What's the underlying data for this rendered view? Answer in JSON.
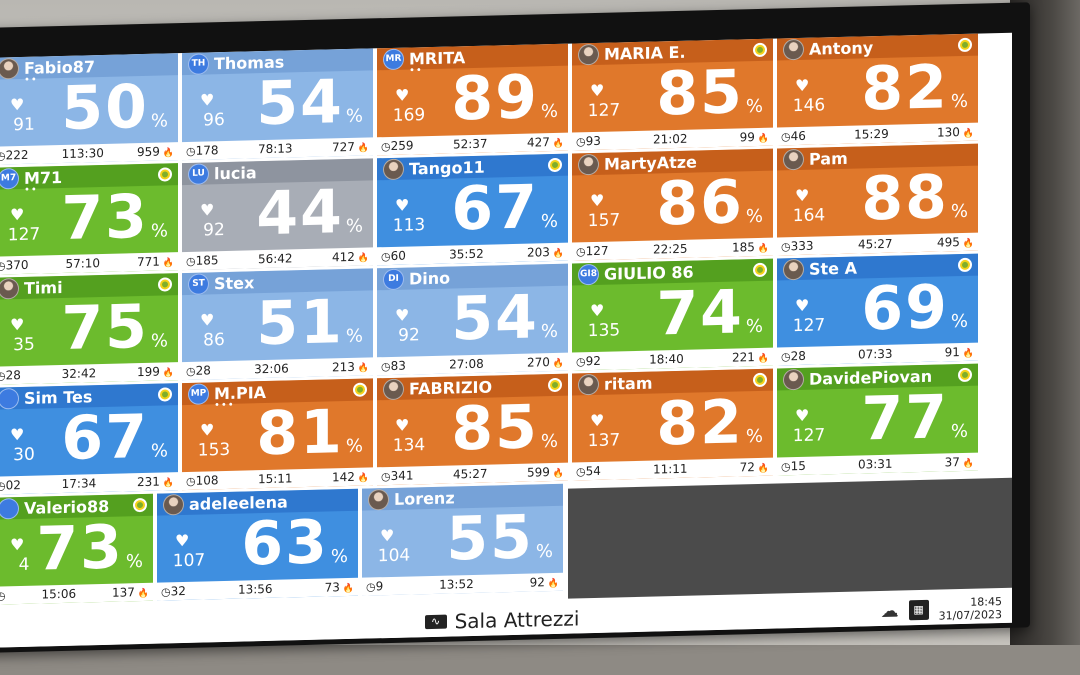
{
  "footer": {
    "room_title": "Sala Attrezzi",
    "time": "18:45",
    "date": "31/07/2023"
  },
  "tiles": [
    {
      "name": "Fabio87",
      "initials": "",
      "photo": true,
      "color": "lblue",
      "bpm": "91",
      "pct": "50",
      "stat1": "222",
      "time": "113:30",
      "kcal": "959",
      "target": false,
      "dots": "••"
    },
    {
      "name": "Thomas",
      "initials": "TH",
      "photo": false,
      "color": "lblue",
      "bpm": "96",
      "pct": "54",
      "stat1": "178",
      "time": "78:13",
      "kcal": "727",
      "target": false,
      "dots": ""
    },
    {
      "name": "MRITA",
      "initials": "MR",
      "photo": false,
      "color": "orange",
      "bpm": "169",
      "pct": "89",
      "stat1": "259",
      "time": "52:37",
      "kcal": "427",
      "target": false,
      "dots": "••"
    },
    {
      "name": "MARIA E.",
      "initials": "",
      "photo": true,
      "color": "orange",
      "bpm": "127",
      "pct": "85",
      "stat1": "93",
      "time": "21:02",
      "kcal": "99",
      "target": true,
      "dots": ""
    },
    {
      "name": "Antony",
      "initials": "",
      "photo": true,
      "color": "orange",
      "bpm": "146",
      "pct": "82",
      "stat1": "46",
      "time": "15:29",
      "kcal": "130",
      "target": true,
      "dots": ""
    },
    {
      "name": "M71",
      "initials": "M7",
      "photo": false,
      "color": "green",
      "bpm": "127",
      "pct": "73",
      "stat1": "370",
      "time": "57:10",
      "kcal": "771",
      "target": true,
      "dots": "••"
    },
    {
      "name": "lucia",
      "initials": "LU",
      "photo": false,
      "color": "gray",
      "bpm": "92",
      "pct": "44",
      "stat1": "185",
      "time": "56:42",
      "kcal": "412",
      "target": false,
      "dots": ""
    },
    {
      "name": "Tango11",
      "initials": "",
      "photo": true,
      "color": "blue",
      "bpm": "113",
      "pct": "67",
      "stat1": "60",
      "time": "35:52",
      "kcal": "203",
      "target": true,
      "dots": ""
    },
    {
      "name": "MartyAtze",
      "initials": "",
      "photo": true,
      "color": "orange",
      "bpm": "157",
      "pct": "86",
      "stat1": "127",
      "time": "22:25",
      "kcal": "185",
      "target": false,
      "dots": ""
    },
    {
      "name": "Pam",
      "initials": "",
      "photo": true,
      "color": "orange",
      "bpm": "164",
      "pct": "88",
      "stat1": "333",
      "time": "45:27",
      "kcal": "495",
      "target": false,
      "dots": ""
    },
    {
      "name": "Timi",
      "initials": "",
      "photo": true,
      "color": "green",
      "bpm": "35",
      "pct": "75",
      "stat1": "28",
      "time": "32:42",
      "kcal": "199",
      "target": true,
      "dots": ""
    },
    {
      "name": "Stex",
      "initials": "ST",
      "photo": false,
      "color": "lblue",
      "bpm": "86",
      "pct": "51",
      "stat1": "28",
      "time": "32:06",
      "kcal": "213",
      "target": false,
      "dots": ""
    },
    {
      "name": "Dino",
      "initials": "DI",
      "photo": false,
      "color": "lblue",
      "bpm": "92",
      "pct": "54",
      "stat1": "83",
      "time": "27:08",
      "kcal": "270",
      "target": false,
      "dots": ""
    },
    {
      "name": "GIULIO 86",
      "initials": "GI8",
      "photo": false,
      "color": "green",
      "bpm": "135",
      "pct": "74",
      "stat1": "92",
      "time": "18:40",
      "kcal": "221",
      "target": true,
      "dots": ""
    },
    {
      "name": "Ste A",
      "initials": "",
      "photo": true,
      "color": "blue",
      "bpm": "127",
      "pct": "69",
      "stat1": "28",
      "time": "07:33",
      "kcal": "91",
      "target": true,
      "dots": ""
    },
    {
      "name": "Sim Tes",
      "initials": "",
      "photo": false,
      "color": "blue",
      "bpm": "30",
      "pct": "67",
      "stat1": "02",
      "time": "17:34",
      "kcal": "231",
      "target": true,
      "dots": ""
    },
    {
      "name": "M.PIA",
      "initials": "MP",
      "photo": false,
      "color": "orange",
      "bpm": "153",
      "pct": "81",
      "stat1": "108",
      "time": "15:11",
      "kcal": "142",
      "target": true,
      "dots": "•••"
    },
    {
      "name": "FABRIZIO",
      "initials": "",
      "photo": true,
      "color": "orange",
      "bpm": "134",
      "pct": "85",
      "stat1": "341",
      "time": "45:27",
      "kcal": "599",
      "target": true,
      "dots": ""
    },
    {
      "name": "ritam",
      "initials": "",
      "photo": true,
      "color": "orange",
      "bpm": "137",
      "pct": "82",
      "stat1": "54",
      "time": "11:11",
      "kcal": "72",
      "target": true,
      "dots": ""
    },
    {
      "name": "DavidePiovan",
      "initials": "",
      "photo": true,
      "color": "green",
      "bpm": "127",
      "pct": "77",
      "stat1": "15",
      "time": "03:31",
      "kcal": "37",
      "target": true,
      "dots": ""
    },
    {
      "name": "Valerio88",
      "initials": "",
      "photo": false,
      "color": "green",
      "bpm": "4",
      "pct": "73",
      "stat1": "",
      "time": "15:06",
      "kcal": "137",
      "target": true,
      "dots": ""
    },
    {
      "name": "adeleelena",
      "initials": "",
      "photo": true,
      "color": "blue",
      "bpm": "107",
      "pct": "63",
      "stat1": "32",
      "time": "13:56",
      "kcal": "73",
      "target": false,
      "dots": ""
    },
    {
      "name": "Lorenz",
      "initials": "",
      "photo": true,
      "color": "lblue",
      "bpm": "104",
      "pct": "55",
      "stat1": "9",
      "time": "13:52",
      "kcal": "92",
      "target": false,
      "dots": ""
    }
  ],
  "icons": {
    "heart": "heart-icon",
    "clock": "clock-icon",
    "flame": "flame-icon",
    "target": "target-icon",
    "cloud": "cloud-icon",
    "building": "building-icon",
    "pulse": "pulse-icon"
  }
}
